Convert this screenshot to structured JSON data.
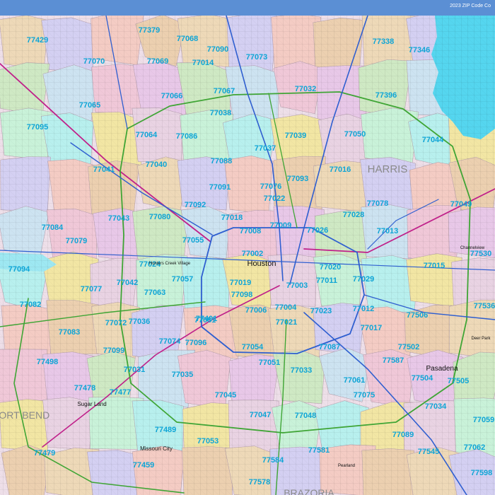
{
  "title": "2023 ZIP Code Co",
  "colors": {
    "zip_label": "#0ea5d6",
    "highway": "#3fa535",
    "arterial": "#2f5fd0",
    "interstate": "#c0208a",
    "water": "#55d6ef"
  },
  "counties": [
    "HARRIS",
    "FORT BEND",
    "BRAZORIA"
  ],
  "cities": [
    "Houston",
    "Pasadena",
    "Sugar Land",
    "Missouri City",
    "Hunters Creek Village",
    "Channelview",
    "Deer Park",
    "Pearland"
  ],
  "zip_codes": [
    "77379",
    "77429",
    "77070",
    "77068",
    "77090",
    "77073",
    "77338",
    "77346",
    "77014",
    "77069",
    "77066",
    "77067",
    "77032",
    "77396",
    "77065",
    "77038",
    "77095",
    "77064",
    "77086",
    "77039",
    "77050",
    "77044",
    "77037",
    "77041",
    "77040",
    "77088",
    "77016",
    "77093",
    "77076",
    "77091",
    "77022",
    "77092",
    "77078",
    "77049",
    "77084",
    "77043",
    "77080",
    "77018",
    "77028",
    "77009",
    "77026",
    "77013",
    "77008",
    "77055",
    "77079",
    "77002",
    "77530",
    "77094",
    "77024",
    "77020",
    "77015",
    "77042",
    "77057",
    "77019",
    "77011",
    "77063",
    "77077",
    "77098",
    "77029",
    "77082",
    "77006",
    "77004",
    "77003",
    "77023",
    "77012",
    "77506",
    "77536",
    "77072",
    "77036",
    "77081",
    "77021",
    "77017",
    "77083",
    "77074",
    "77401",
    "77096",
    "77054",
    "77087",
    "77502",
    "77099",
    "77498",
    "77035",
    "77051",
    "77033",
    "77587",
    "77031",
    "77504",
    "77505",
    "77478",
    "77061",
    "77075",
    "77477",
    "77045",
    "77034",
    "77047",
    "77048",
    "77489",
    "77053",
    "77089",
    "77059",
    "77479",
    "77581",
    "77545",
    "77062",
    "77459",
    "77584",
    "77598",
    "77578"
  ]
}
